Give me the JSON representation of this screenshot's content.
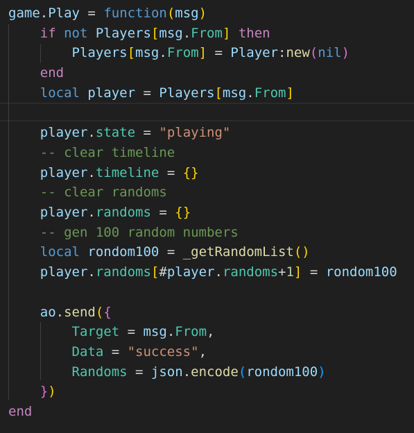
{
  "editor": {
    "language": "lua",
    "theme_background": "#1f1f1f",
    "top_fragment": "--",
    "lines": [
      [
        [
          "game",
          "var"
        ],
        [
          ".",
          "op"
        ],
        [
          "Play",
          "var"
        ],
        [
          " = ",
          "op"
        ],
        [
          "function",
          "kwb"
        ],
        [
          "(",
          "b1"
        ],
        [
          "msg",
          "var"
        ],
        [
          ")",
          "b1"
        ]
      ],
      [
        [
          "    ",
          "op"
        ],
        [
          "if",
          "kw"
        ],
        [
          " not ",
          "kwb"
        ],
        [
          "Players",
          "var"
        ],
        [
          "[",
          "b1"
        ],
        [
          "msg",
          "var"
        ],
        [
          ".",
          "op"
        ],
        [
          "From",
          "prop"
        ],
        [
          "]",
          "b1"
        ],
        [
          " ",
          "op"
        ],
        [
          "then",
          "kw"
        ]
      ],
      [
        [
          "        ",
          "op"
        ],
        [
          "Players",
          "var"
        ],
        [
          "[",
          "b1"
        ],
        [
          "msg",
          "var"
        ],
        [
          ".",
          "op"
        ],
        [
          "From",
          "prop"
        ],
        [
          "]",
          "b1"
        ],
        [
          " = ",
          "op"
        ],
        [
          "Player",
          "var"
        ],
        [
          ":",
          "op"
        ],
        [
          "new",
          "fn"
        ],
        [
          "(",
          "b2"
        ],
        [
          "nil",
          "kwb"
        ],
        [
          ")",
          "b2"
        ]
      ],
      [
        [
          "    ",
          "op"
        ],
        [
          "end",
          "kw"
        ]
      ],
      [
        [
          "    ",
          "op"
        ],
        [
          "local",
          "kwb"
        ],
        [
          " ",
          "op"
        ],
        [
          "player",
          "var"
        ],
        [
          " = ",
          "op"
        ],
        [
          "Players",
          "var"
        ],
        [
          "[",
          "b1"
        ],
        [
          "msg",
          "var"
        ],
        [
          ".",
          "op"
        ],
        [
          "From",
          "prop"
        ],
        [
          "]",
          "b1"
        ]
      ],
      [],
      [
        [
          "    ",
          "op"
        ],
        [
          "player",
          "var"
        ],
        [
          ".",
          "op"
        ],
        [
          "state",
          "prop"
        ],
        [
          " = ",
          "op"
        ],
        [
          "\"playing\"",
          "str"
        ]
      ],
      [
        [
          "    ",
          "op"
        ],
        [
          "-- clear timeline",
          "com"
        ]
      ],
      [
        [
          "    ",
          "op"
        ],
        [
          "player",
          "var"
        ],
        [
          ".",
          "op"
        ],
        [
          "timeline",
          "prop"
        ],
        [
          " = ",
          "op"
        ],
        [
          "{}",
          "b1"
        ]
      ],
      [
        [
          "    ",
          "op"
        ],
        [
          "-- clear randoms",
          "com"
        ]
      ],
      [
        [
          "    ",
          "op"
        ],
        [
          "player",
          "var"
        ],
        [
          ".",
          "op"
        ],
        [
          "randoms",
          "prop"
        ],
        [
          " = ",
          "op"
        ],
        [
          "{}",
          "b1"
        ]
      ],
      [
        [
          "    ",
          "op"
        ],
        [
          "-- gen 100 random numbers",
          "com"
        ]
      ],
      [
        [
          "    ",
          "op"
        ],
        [
          "local",
          "kwb"
        ],
        [
          " ",
          "op"
        ],
        [
          "rondom100",
          "var"
        ],
        [
          " = ",
          "op"
        ],
        [
          "_getRandomList",
          "fn"
        ],
        [
          "()",
          "b1"
        ]
      ],
      [
        [
          "    ",
          "op"
        ],
        [
          "player",
          "var"
        ],
        [
          ".",
          "op"
        ],
        [
          "randoms",
          "prop"
        ],
        [
          "[",
          "b1"
        ],
        [
          "#",
          "op"
        ],
        [
          "player",
          "var"
        ],
        [
          ".",
          "op"
        ],
        [
          "randoms",
          "prop"
        ],
        [
          "+",
          "op"
        ],
        [
          "1",
          "num"
        ],
        [
          "]",
          "b1"
        ],
        [
          " = ",
          "op"
        ],
        [
          "rondom100",
          "var"
        ]
      ],
      [],
      [
        [
          "    ",
          "op"
        ],
        [
          "ao",
          "var"
        ],
        [
          ".",
          "op"
        ],
        [
          "send",
          "fn"
        ],
        [
          "(",
          "b1"
        ],
        [
          "{",
          "b2"
        ]
      ],
      [
        [
          "        ",
          "op"
        ],
        [
          "Target",
          "prop"
        ],
        [
          " = ",
          "op"
        ],
        [
          "msg",
          "var"
        ],
        [
          ".",
          "op"
        ],
        [
          "From",
          "prop"
        ],
        [
          ",",
          "op"
        ]
      ],
      [
        [
          "        ",
          "op"
        ],
        [
          "Data",
          "prop"
        ],
        [
          " = ",
          "op"
        ],
        [
          "\"success\"",
          "str"
        ],
        [
          ",",
          "op"
        ]
      ],
      [
        [
          "        ",
          "op"
        ],
        [
          "Randoms",
          "prop"
        ],
        [
          " = ",
          "op"
        ],
        [
          "json",
          "var"
        ],
        [
          ".",
          "op"
        ],
        [
          "encode",
          "fn"
        ],
        [
          "(",
          "b3"
        ],
        [
          "rondom100",
          "var"
        ],
        [
          ")",
          "b3"
        ]
      ],
      [
        [
          "    ",
          "op"
        ],
        [
          "}",
          "b2"
        ],
        [
          ")",
          "b1"
        ]
      ],
      [
        [
          "end",
          "kw"
        ]
      ]
    ]
  }
}
